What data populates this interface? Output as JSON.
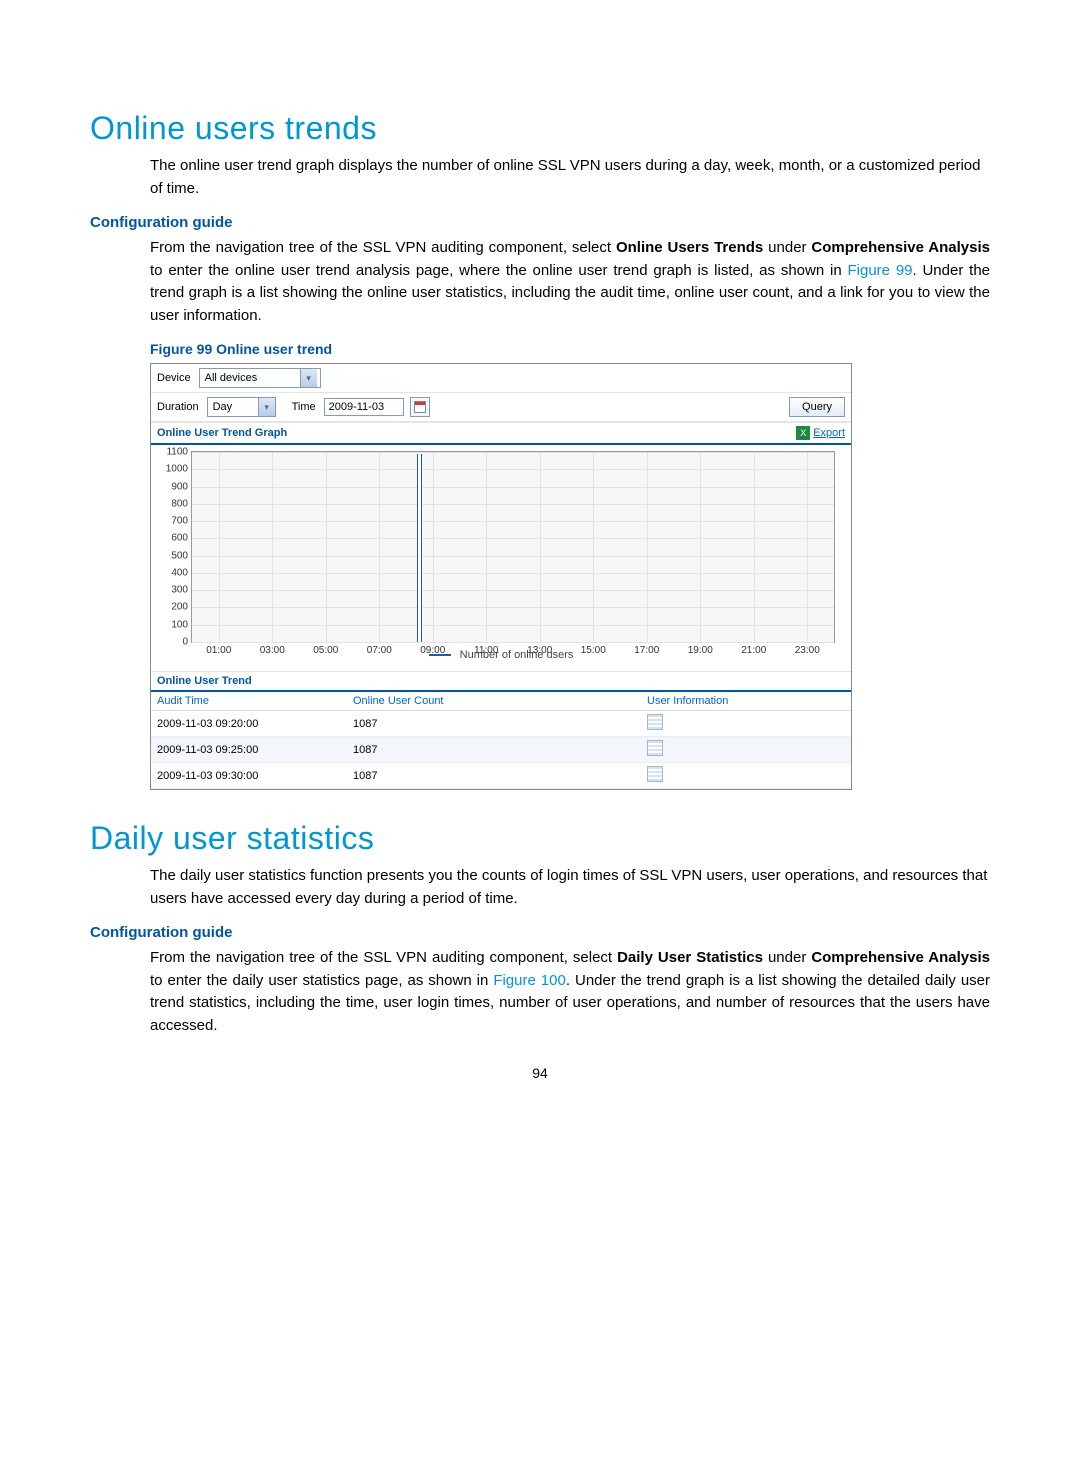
{
  "page_number": "94",
  "section1": {
    "title": "Online users trends",
    "intro": "The online user trend graph displays the number of online SSL VPN users during a day, week, month, or a customized period of time.",
    "subhead": "Configuration guide",
    "body_pre": "From the navigation tree of the SSL VPN auditing component, select ",
    "body_bold1": "Online Users Trends",
    "body_mid1": " under ",
    "body_bold2": "Comprehensive Analysis",
    "body_mid2": " to enter the online user trend analysis page, where the online user trend graph is listed, as shown in ",
    "body_link": "Figure 99",
    "body_post": ". Under the trend graph is a list showing the online user statistics, including the audit time, online user count, and a link for you to view the user information.",
    "fig_caption": "Figure 99 Online user trend"
  },
  "filters": {
    "device_label": "Device",
    "device_value": "All devices",
    "duration_label": "Duration",
    "duration_value": "Day",
    "time_label": "Time",
    "time_value": "2009-11-03",
    "query_label": "Query"
  },
  "chart_panel_title": "Online User Trend Graph",
  "export_label": "Export",
  "chart_data": {
    "type": "line",
    "title": "",
    "xlabel": "",
    "ylabel": "",
    "categories": [
      "01:00",
      "03:00",
      "05:00",
      "07:00",
      "09:00",
      "11:00",
      "13:00",
      "15:00",
      "17:00",
      "19:00",
      "21:00",
      "23:00"
    ],
    "ylim": [
      0,
      1100
    ],
    "yticks": [
      0,
      100,
      200,
      300,
      400,
      500,
      600,
      700,
      800,
      900,
      1000,
      1100
    ],
    "series": [
      {
        "name": "Number of online users",
        "values": [
          0,
          0,
          0,
          0,
          0,
          0,
          0,
          0,
          1087,
          0,
          0,
          0,
          0,
          0,
          0,
          0,
          0,
          0,
          0,
          0,
          0,
          0,
          0,
          0
        ]
      }
    ]
  },
  "table_panel_title": "Online User Trend",
  "table": {
    "columns": [
      "Audit Time",
      "Online User Count",
      "User Information"
    ],
    "rows": [
      {
        "time": "2009-11-03 09:20:00",
        "count": "1087"
      },
      {
        "time": "2009-11-03 09:25:00",
        "count": "1087"
      },
      {
        "time": "2009-11-03 09:30:00",
        "count": "1087"
      }
    ]
  },
  "section2": {
    "title": "Daily user statistics",
    "intro": "The daily user statistics function presents you the counts of login times of SSL VPN users, user operations, and resources that users have accessed every day during a period of time.",
    "subhead": "Configuration guide",
    "body_pre": "From the navigation tree of the SSL VPN auditing component, select ",
    "body_bold1": "Daily User Statistics",
    "body_mid1": " under ",
    "body_bold2": "Comprehensive Analysis",
    "body_mid2": " to enter the daily user statistics page, as shown in ",
    "body_link": "Figure 100",
    "body_post": ". Under the trend graph is a list showing the detailed daily user trend statistics, including the time, user login times, number of user operations, and number of resources that the users have accessed."
  }
}
